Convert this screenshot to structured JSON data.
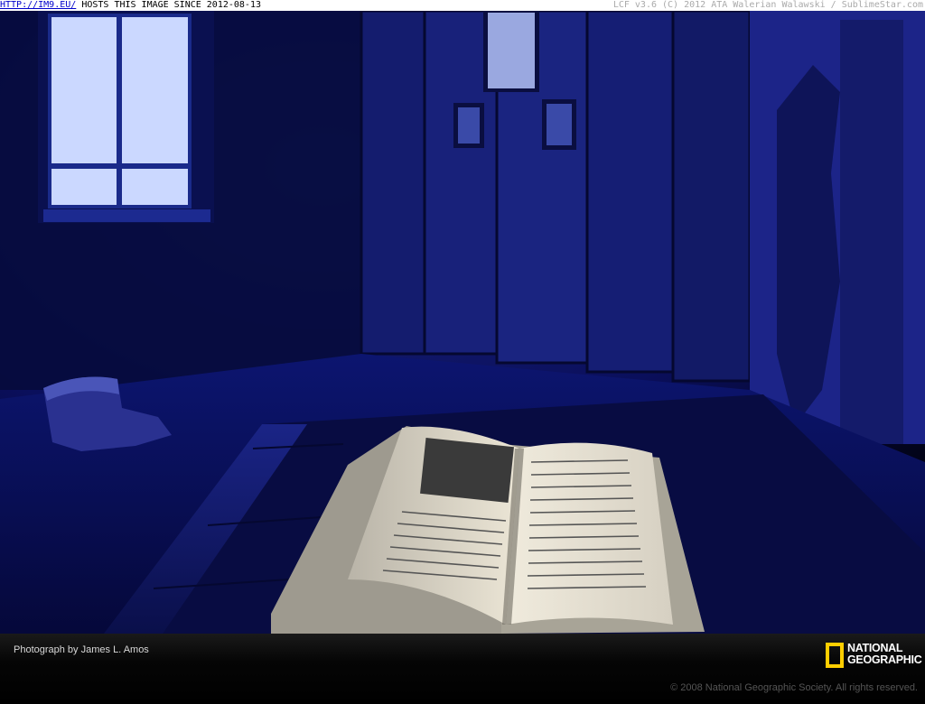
{
  "topbar": {
    "host_link": "HTTP://IM9.EU/",
    "host_text": " HOSTS THIS IMAGE SINCE 2012-08-13",
    "right_text": "LCF v3.6 (C) 2012 ATA Walerian Walawski / SublimeStar.com"
  },
  "photo": {
    "subject": "open-book-on-wooden-table-in-dim-blue-room",
    "colors": {
      "room": "#0a0f5c",
      "window_glow": "#c8d8ff",
      "book_page": "#e8e2d0"
    }
  },
  "caption": {
    "credit": "Photograph by James L. Amos",
    "logo_line1": "NATIONAL",
    "logo_line2": "GEOGRAPHIC",
    "logo_color": "#ffce00",
    "copyright": "© 2008 National Geographic Society. All rights reserved."
  }
}
